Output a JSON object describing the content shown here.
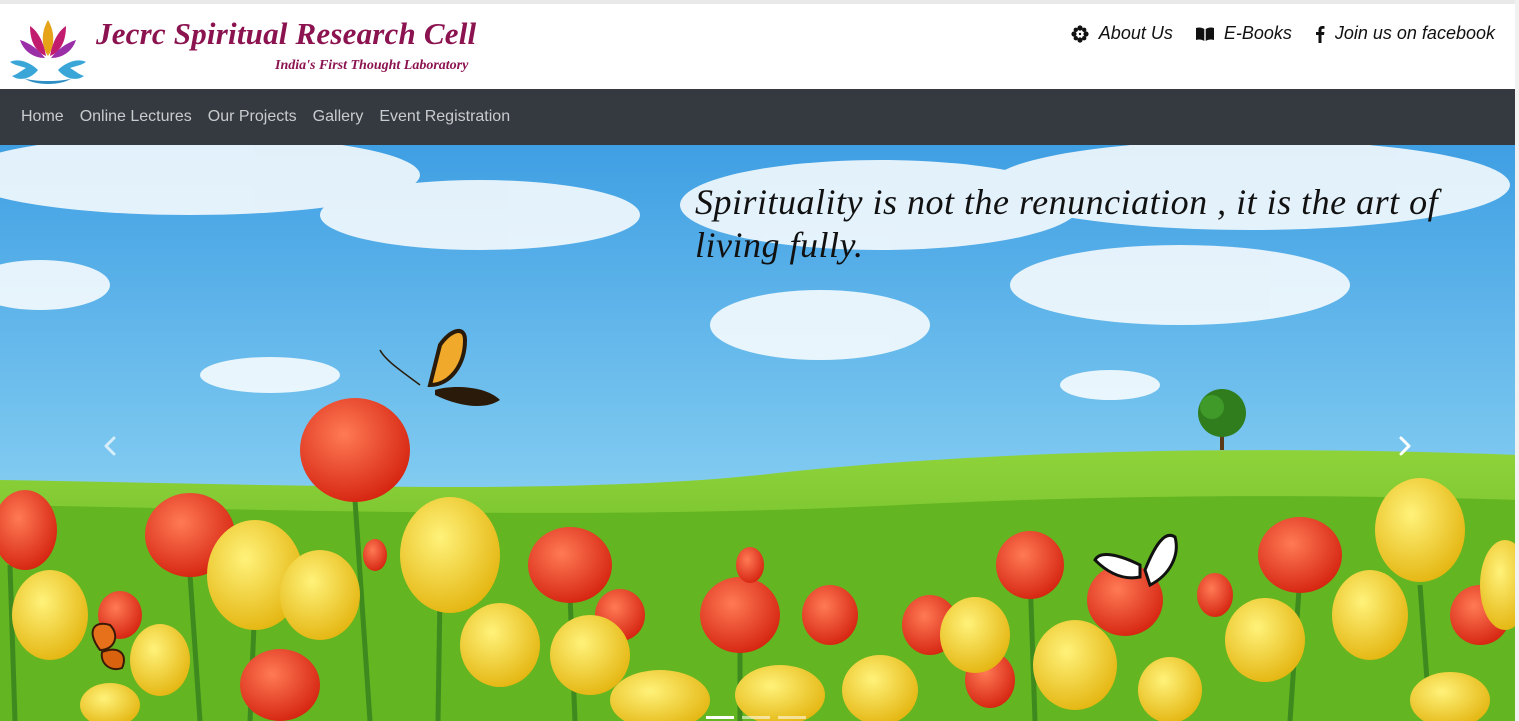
{
  "brand": {
    "title": "Jecrc Spiritual Research Cell",
    "subtitle": "India's First Thought Laboratory"
  },
  "top_links": [
    {
      "label": "About Us",
      "icon": "flower-icon"
    },
    {
      "label": "E-Books",
      "icon": "book-icon"
    },
    {
      "label": "Join us on facebook",
      "icon": "facebook-icon"
    }
  ],
  "nav": {
    "items": [
      {
        "label": "Home"
      },
      {
        "label": "Online Lectures"
      },
      {
        "label": "Our Projects"
      },
      {
        "label": "Gallery"
      },
      {
        "label": "Event Registration"
      }
    ]
  },
  "hero": {
    "quote": "Spirituality is not the renunciation , it is the art of living fully.",
    "slides_count": 3,
    "active_slide": 1
  },
  "colors": {
    "brand": "#8b1350",
    "navbar": "#343a40",
    "nav_text": "#c9ccce",
    "sky": "#5fb8ec",
    "grass": "#6fc128"
  }
}
